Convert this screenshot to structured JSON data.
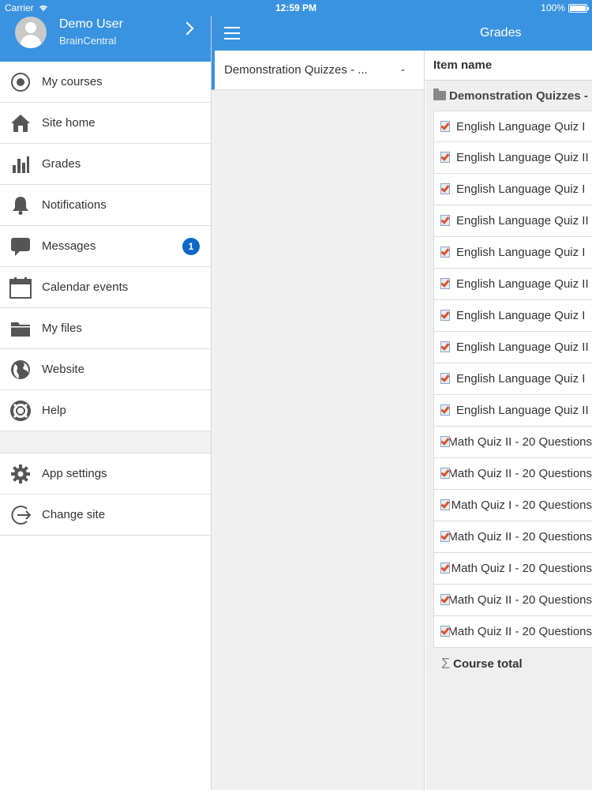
{
  "status_bar": {
    "carrier": "Carrier",
    "time": "12:59 PM",
    "battery": "100%"
  },
  "user": {
    "name": "Demo User",
    "site": "BrainCentral"
  },
  "menu": {
    "items": [
      {
        "label": "My courses",
        "icon": "my-courses-icon"
      },
      {
        "label": "Site home",
        "icon": "home-icon"
      },
      {
        "label": "Grades",
        "icon": "grades-bar-chart-icon"
      },
      {
        "label": "Notifications",
        "icon": "bell-icon"
      },
      {
        "label": "Messages",
        "icon": "chat-bubble-icon",
        "badge": "1"
      },
      {
        "label": "Calendar events",
        "icon": "calendar-icon"
      },
      {
        "label": "My files",
        "icon": "folder-icon"
      },
      {
        "label": "Website",
        "icon": "globe-icon"
      },
      {
        "label": "Help",
        "icon": "lifebuoy-icon"
      }
    ],
    "secondary": [
      {
        "label": "App settings",
        "icon": "gear-icon"
      },
      {
        "label": "Change site",
        "icon": "exit-icon"
      }
    ]
  },
  "appbar": {
    "title": "Grades"
  },
  "courses": [
    {
      "name": "Demonstration Quizzes - ...",
      "grade": "-"
    }
  ],
  "grades": {
    "header": "Item name",
    "category": "Demonstration Quizzes -",
    "items": [
      "English Language Quiz I",
      "English Language Quiz II",
      "English Language Quiz I",
      "English Language Quiz II",
      "English Language Quiz I",
      "English Language Quiz II",
      "English Language Quiz I",
      "English Language Quiz II",
      "English Language Quiz I",
      "English Language Quiz II",
      "Math Quiz II - 20 Questions",
      "Math Quiz II - 20 Questions",
      "Math Quiz I - 20 Questions",
      "Math Quiz II - 20 Questions",
      "Math Quiz I - 20 Questions",
      "Math Quiz II - 20 Questions",
      "Math Quiz II - 20 Questions"
    ],
    "total": "Course total",
    "total_symbol": "Σ"
  }
}
